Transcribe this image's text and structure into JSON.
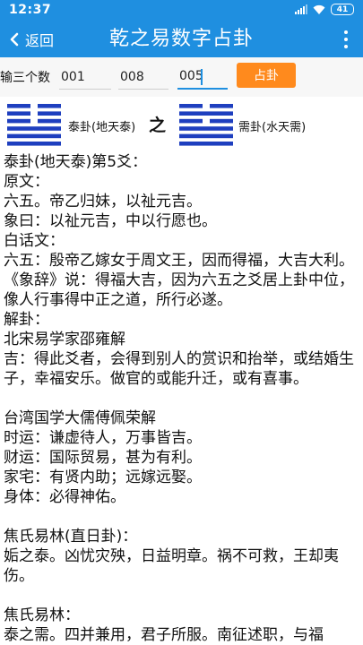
{
  "status_bar": {
    "time": "12:37",
    "battery": "41",
    "icons": [
      "signal-icon",
      "wifi-icon",
      "battery-icon"
    ]
  },
  "app_bar": {
    "back_label": "返回",
    "title": "乾之易数字占卦",
    "colors": {
      "bar": "#1f8fe0",
      "text": "#ffffff"
    }
  },
  "input_row": {
    "label": "输三个数",
    "inputs": [
      "001",
      "008",
      "005"
    ],
    "button_label": "占卦",
    "button_color": "#ff8a1d"
  },
  "hexagrams": {
    "primary": {
      "name": "泰卦(地天泰)",
      "lines_top_to_bottom": [
        "yin",
        "yin",
        "yin",
        "yang",
        "yang",
        "yang"
      ]
    },
    "connector": "之",
    "changed": {
      "name": "需卦(水天需)",
      "lines_top_to_bottom": [
        "yin",
        "yang",
        "yin",
        "yang",
        "yang",
        "yang"
      ]
    },
    "line_color": "#1e3fbf"
  },
  "content": [
    "泰卦(地天泰)第5爻：",
    "原文：",
    "六五。帝乙归妹，以祉元吉。",
    "象曰：以祉元吉，中以行愿也。",
    "白话文：",
    "六五：殷帝乙嫁女于周文王，因而得福，大吉大利。",
    "《象辞》说：得福大吉，因为六五之爻居上卦中位，像人行事得中正之道，所行必遂。",
    "解卦：",
    "北宋易学家邵雍解",
    "吉：得此爻者，会得到别人的赏识和抬举，或结婚生子，幸福安乐。做官的或能升迁，或有喜事。",
    "",
    "台湾国学大儒傅佩荣解",
    "时运：谦虚待人，万事皆吉。",
    "财运：国际贸易，甚为有利。",
    "家宅：有贤内助；远嫁远娶。",
    "身体：必得神佑。",
    "",
    "焦氏易林(直日卦)：",
    "姤之泰。凶忧灾殃，日益明章。祸不可救，王却夷伤。",
    "",
    "焦氏易林：",
    "泰之需。四并兼用，君子所服。南征述职，与福"
  ]
}
